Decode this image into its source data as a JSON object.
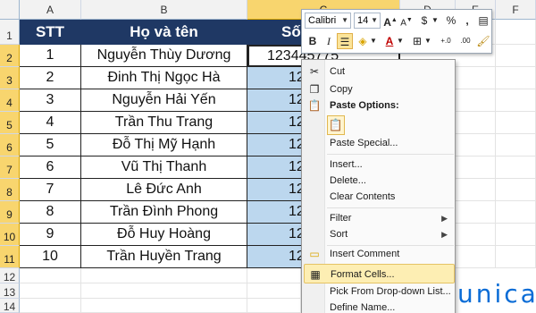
{
  "columns": [
    "A",
    "B",
    "C",
    "D",
    "E",
    "F"
  ],
  "rows": [
    "1",
    "2",
    "3",
    "4",
    "5",
    "6",
    "7",
    "8",
    "9",
    "10",
    "11",
    "12",
    "13",
    "14"
  ],
  "table": {
    "headers": [
      "STT",
      "Họ và tên",
      "Số"
    ],
    "rows": [
      {
        "stt": "1",
        "name": "Nguyễn Thùy Dương",
        "num": "123445775"
      },
      {
        "stt": "2",
        "name": "Đinh Thị Ngọc Hà",
        "num": "12"
      },
      {
        "stt": "3",
        "name": "Nguyễn Hải Yến",
        "num": "12"
      },
      {
        "stt": "4",
        "name": "Trần Thu Trang",
        "num": "12"
      },
      {
        "stt": "5",
        "name": "Đỗ Thị Mỹ Hạnh",
        "num": "12"
      },
      {
        "stt": "6",
        "name": "Vũ Thị Thanh",
        "num": "12"
      },
      {
        "stt": "7",
        "name": "Lê Đức Anh",
        "num": "12"
      },
      {
        "stt": "8",
        "name": "Trần Đình Phong",
        "num": "12"
      },
      {
        "stt": "9",
        "name": "Đỗ Huy Hoàng",
        "num": "12"
      },
      {
        "stt": "10",
        "name": "Trần Huyền Trang",
        "num": "12"
      }
    ]
  },
  "mini_toolbar": {
    "font": "Calibri",
    "size": "14",
    "grow_font": "A",
    "shrink_font": "A",
    "currency": "$",
    "percent": "%",
    "comma": ",",
    "bold": "B",
    "italic": "I",
    "font_color": "A",
    "dec_increase": "+.0",
    "dec_decrease": ".00"
  },
  "context_menu": {
    "cut": "Cut",
    "copy": "Copy",
    "paste_options": "Paste Options:",
    "paste_special": "Paste Special...",
    "insert": "Insert...",
    "delete": "Delete...",
    "clear_contents": "Clear Contents",
    "filter": "Filter",
    "sort": "Sort",
    "insert_comment": "Insert Comment",
    "format_cells": "Format Cells...",
    "pick_list": "Pick From Drop-down List...",
    "define_name": "Define Name..."
  },
  "logo": {
    "text": "unica"
  },
  "colors": {
    "header_fill": "#1f3864",
    "selection": "#bcd7ee",
    "highlight": "#fdeeb3",
    "logo": "#0a6cd6"
  }
}
